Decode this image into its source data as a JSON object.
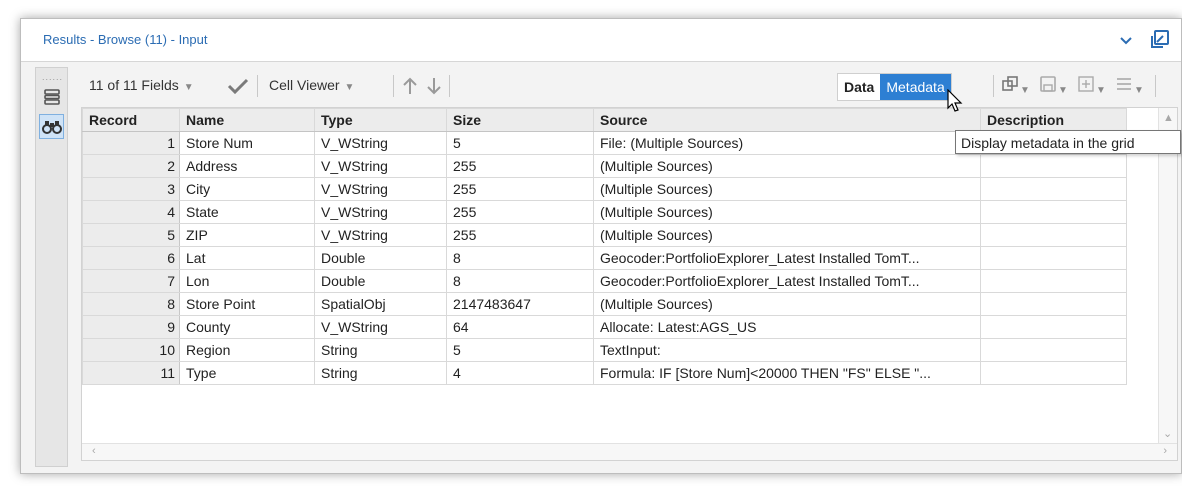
{
  "window": {
    "title": "Results - Browse (11) - Input",
    "colors": {
      "accent": "#2d7fd3",
      "title": "#2b6cb3"
    }
  },
  "rail": {
    "grip": "......",
    "items": [
      {
        "icon": "list-icon",
        "active": false
      },
      {
        "icon": "binoculars-icon",
        "active": true
      }
    ]
  },
  "toolbar": {
    "fields_label": "11 of 11 Fields",
    "cell_viewer_label": "Cell Viewer",
    "view_toggle": {
      "data_label": "Data",
      "metadata_label": "Metadata",
      "selected": "Metadata"
    }
  },
  "tooltip": {
    "text": "Display metadata in the grid"
  },
  "grid": {
    "columns": [
      "Record",
      "Name",
      "Type",
      "Size",
      "Source",
      "Description"
    ],
    "rows": [
      {
        "record": "1",
        "name": "Store Num",
        "type": "V_WString",
        "size": "5",
        "source": "File: (Multiple Sources)",
        "description": ""
      },
      {
        "record": "2",
        "name": "Address",
        "type": "V_WString",
        "size": "255",
        "source": "(Multiple Sources)",
        "description": ""
      },
      {
        "record": "3",
        "name": "City",
        "type": "V_WString",
        "size": "255",
        "source": "(Multiple Sources)",
        "description": ""
      },
      {
        "record": "4",
        "name": "State",
        "type": "V_WString",
        "size": "255",
        "source": "(Multiple Sources)",
        "description": ""
      },
      {
        "record": "5",
        "name": "ZIP",
        "type": "V_WString",
        "size": "255",
        "source": "(Multiple Sources)",
        "description": ""
      },
      {
        "record": "6",
        "name": "Lat",
        "type": "Double",
        "size": "8",
        "source": "Geocoder:PortfolioExplorer_Latest Installed TomT...",
        "description": ""
      },
      {
        "record": "7",
        "name": "Lon",
        "type": "Double",
        "size": "8",
        "source": "Geocoder:PortfolioExplorer_Latest Installed TomT...",
        "description": ""
      },
      {
        "record": "8",
        "name": "Store Point",
        "type": "SpatialObj",
        "size": "2147483647",
        "source": "(Multiple Sources)",
        "description": ""
      },
      {
        "record": "9",
        "name": "County",
        "type": "V_WString",
        "size": "64",
        "source": "Allocate: Latest:AGS_US",
        "description": ""
      },
      {
        "record": "10",
        "name": "Region",
        "type": "String",
        "size": "5",
        "source": "TextInput:",
        "description": ""
      },
      {
        "record": "11",
        "name": "Type",
        "type": "String",
        "size": "4",
        "source": "Formula: IF [Store Num]<20000 THEN \"FS\" ELSE \"...",
        "description": ""
      }
    ]
  }
}
